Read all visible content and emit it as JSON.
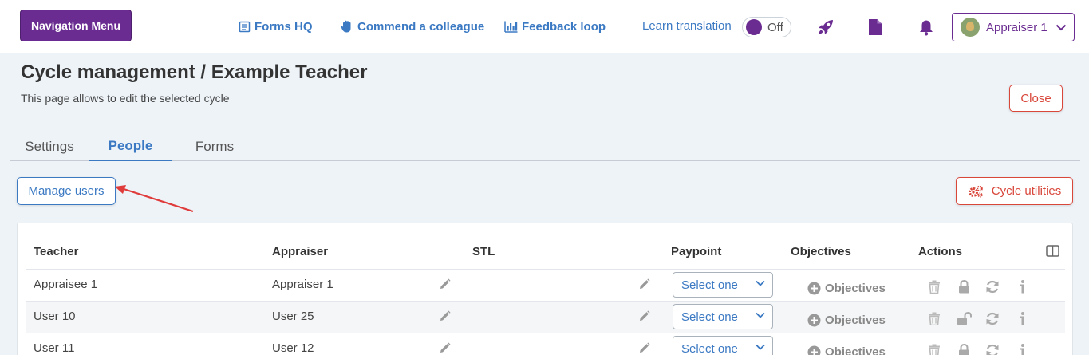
{
  "topbar": {
    "nav_menu_label": "Navigation Menu",
    "links": [
      {
        "label": "Forms HQ",
        "icon": "forms-icon"
      },
      {
        "label": "Commend a colleague",
        "icon": "hand-icon"
      },
      {
        "label": "Feedback loop",
        "icon": "bar-chart-icon"
      }
    ],
    "learn_translation": "Learn translation",
    "toggle_state": "Off",
    "user_label": "Appraiser 1",
    "accent_color": "#6a2c91"
  },
  "page": {
    "title": "Cycle management / Example Teacher",
    "description": "This page allows to edit the selected cycle",
    "close_label": "Close"
  },
  "tabs": [
    {
      "label": "Settings"
    },
    {
      "label": "People",
      "active": true
    },
    {
      "label": "Forms"
    }
  ],
  "buttons": {
    "manage_users": "Manage users",
    "cycle_utilities": "Cycle utilities"
  },
  "table": {
    "headers": {
      "teacher": "Teacher",
      "appraiser": "Appraiser",
      "stl": "STL",
      "paypoint": "Paypoint",
      "objectives": "Objectives",
      "actions": "Actions"
    },
    "rows": [
      {
        "teacher": "Appraisee 1",
        "appraiser": "Appraiser 1",
        "paypoint": "Select one",
        "objectives": "Objectives",
        "lock": "locked"
      },
      {
        "teacher": "User 10",
        "appraiser": "User 25",
        "paypoint": "Select one",
        "objectives": "Objectives",
        "lock": "unlocked"
      },
      {
        "teacher": "User 11",
        "appraiser": "User 12",
        "paypoint": "Select one",
        "objectives": "Objectives",
        "lock": "locked"
      }
    ]
  }
}
